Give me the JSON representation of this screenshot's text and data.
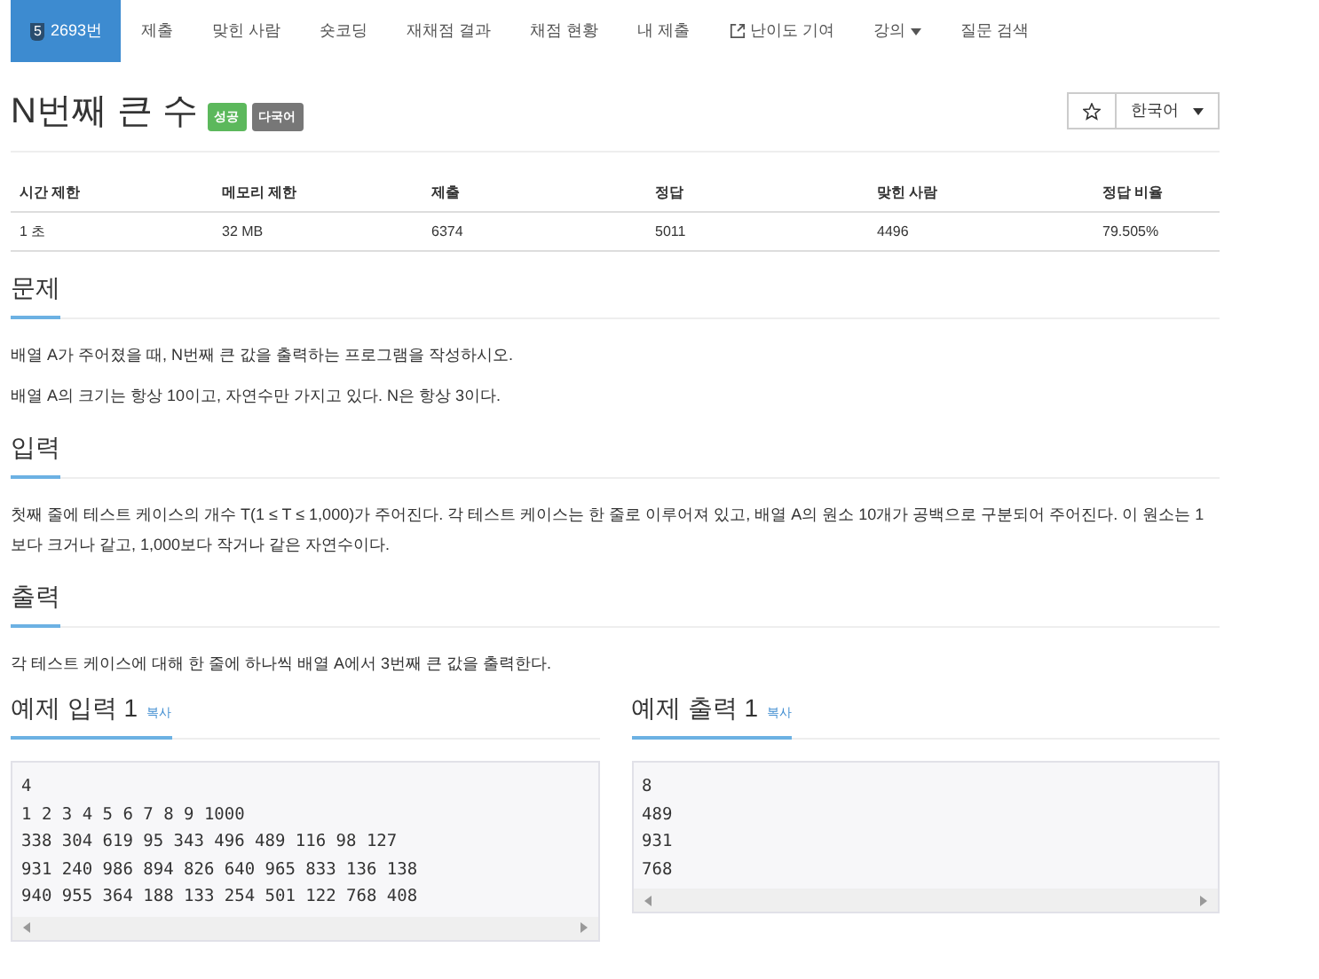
{
  "nav": {
    "items": [
      {
        "label": "2693번",
        "kind": "problem",
        "badge": "5",
        "selected": true
      },
      {
        "label": "제출",
        "kind": "link",
        "selected": false
      },
      {
        "label": "맞힌 사람",
        "kind": "link",
        "selected": false
      },
      {
        "label": "숏코딩",
        "kind": "link",
        "selected": false
      },
      {
        "label": "재채점 결과",
        "kind": "link",
        "selected": false
      },
      {
        "label": "채점 현황",
        "kind": "link",
        "selected": false
      },
      {
        "label": "내 제출",
        "kind": "link",
        "selected": false
      },
      {
        "label": "난이도 기여",
        "kind": "external",
        "selected": false
      },
      {
        "label": "강의",
        "kind": "dropdown",
        "selected": false
      },
      {
        "label": "질문 검색",
        "kind": "link",
        "selected": false
      }
    ]
  },
  "title": "N번째 큰 수",
  "labels": [
    {
      "text": "성공",
      "color": "#5cb85c"
    },
    {
      "text": "다국어",
      "color": "#777777"
    }
  ],
  "language": "한국어",
  "table": {
    "columns": [
      "시간 제한",
      "메모리 제한",
      "제출",
      "정답",
      "맞힌 사람",
      "정답 비율"
    ],
    "rows": [
      [
        "1 초",
        "32 MB",
        "6374",
        "5011",
        "4496",
        "79.505%"
      ]
    ]
  },
  "sections": [
    {
      "heading": "문제",
      "paragraphs": [
        "배열 A가 주어졌을 때, N번째 큰 값을 출력하는 프로그램을 작성하시오.",
        "배열 A의 크기는 항상 10이고, 자연수만 가지고 있다. N은 항상 3이다."
      ]
    },
    {
      "heading": "입력",
      "paragraphs": [
        "첫째 줄에 테스트 케이스의 개수 T(1 ≤ T ≤ 1,000)가 주어진다. 각 테스트 케이스는 한 줄로 이루어져 있고, 배열 A의 원소 10개가 공백으로 구분되어 주어진다. 이 원소는 1보다 크거나 같고, 1,000보다 작거나 같은 자연수이다."
      ]
    },
    {
      "heading": "출력",
      "paragraphs": [
        "각 테스트 케이스에 대해 한 줄에 하나씩 배열 A에서 3번째 큰 값을 출력한다."
      ]
    }
  ],
  "samples": [
    {
      "heading": "예제 입력 1",
      "copy": "복사",
      "lines": [
        "4",
        "1 2 3 4 5 6 7 8 9 1000",
        "338 304 619 95 343 496 489 116 98 127",
        "931 240 986 894 826 640 965 833 136 138",
        "940 955 364 188 133 254 501 122 768 408"
      ]
    },
    {
      "heading": "예제 출력 1",
      "copy": "복사",
      "lines": [
        "8",
        "489",
        "931",
        "768"
      ]
    }
  ]
}
